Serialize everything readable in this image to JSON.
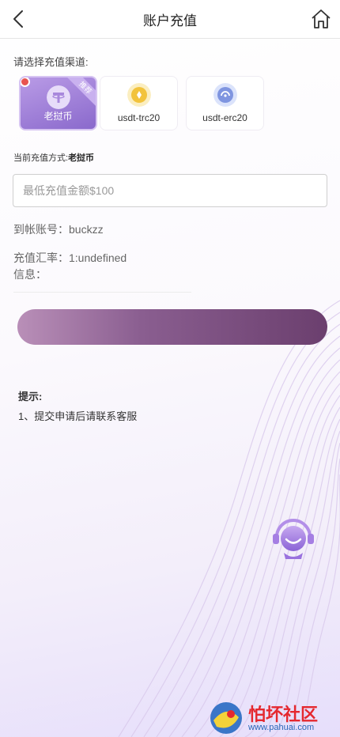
{
  "header": {
    "title": "账户充值"
  },
  "channel_section": {
    "label": "请选择充值渠道:",
    "channels": [
      {
        "label": "老挝币",
        "badge": "推荐",
        "selected": true
      },
      {
        "label": "usdt-trc20",
        "selected": false
      },
      {
        "label": "usdt-erc20",
        "selected": false
      }
    ]
  },
  "method": {
    "prefix": "当前充值方式:",
    "value": "老挝币"
  },
  "amount_input": {
    "placeholder": "最低充值金额$100",
    "value": ""
  },
  "account": {
    "text": "到帐账号：buckzz"
  },
  "rate": {
    "text": "充值汇率：1:undefined"
  },
  "info": {
    "text": "信息："
  },
  "tips": {
    "title": "提示:",
    "items": [
      "1、提交申请后请联系客服"
    ]
  },
  "watermark": {
    "name": "怕坏社区",
    "url": "www.pahuai.com"
  },
  "colors": {
    "accent": "#8a69cc",
    "button_start": "#b98fb8",
    "button_end": "#6b3f6e",
    "watermark_red": "#e5282f"
  }
}
